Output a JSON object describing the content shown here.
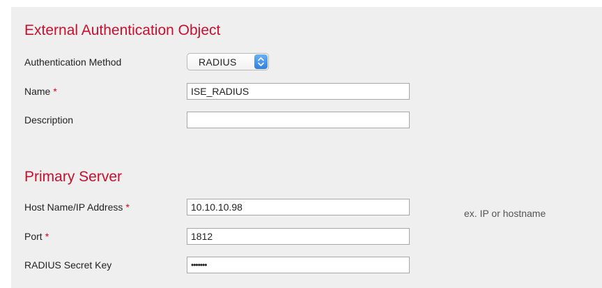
{
  "external_auth": {
    "title": "External Authentication Object",
    "auth_method": {
      "label": "Authentication Method",
      "value": "RADIUS"
    },
    "name": {
      "label": "Name",
      "required_marker": "*",
      "value": "ISE_RADIUS"
    },
    "description": {
      "label": "Description",
      "value": ""
    }
  },
  "primary_server": {
    "title": "Primary Server",
    "host": {
      "label": "Host Name/IP Address",
      "required_marker": "*",
      "value": "10.10.10.98",
      "hint": "ex. IP or hostname"
    },
    "port": {
      "label": "Port",
      "required_marker": "*",
      "value": "1812"
    },
    "secret": {
      "label": "RADIUS Secret Key",
      "value": "•••••••"
    }
  },
  "colors": {
    "section_title": "#c8102e",
    "required_marker": "#d0021b",
    "panel_background": "#efefef",
    "select_arrow": "#2f7fe0"
  },
  "icons": {
    "select_arrows": "updown-chevron-icon"
  }
}
